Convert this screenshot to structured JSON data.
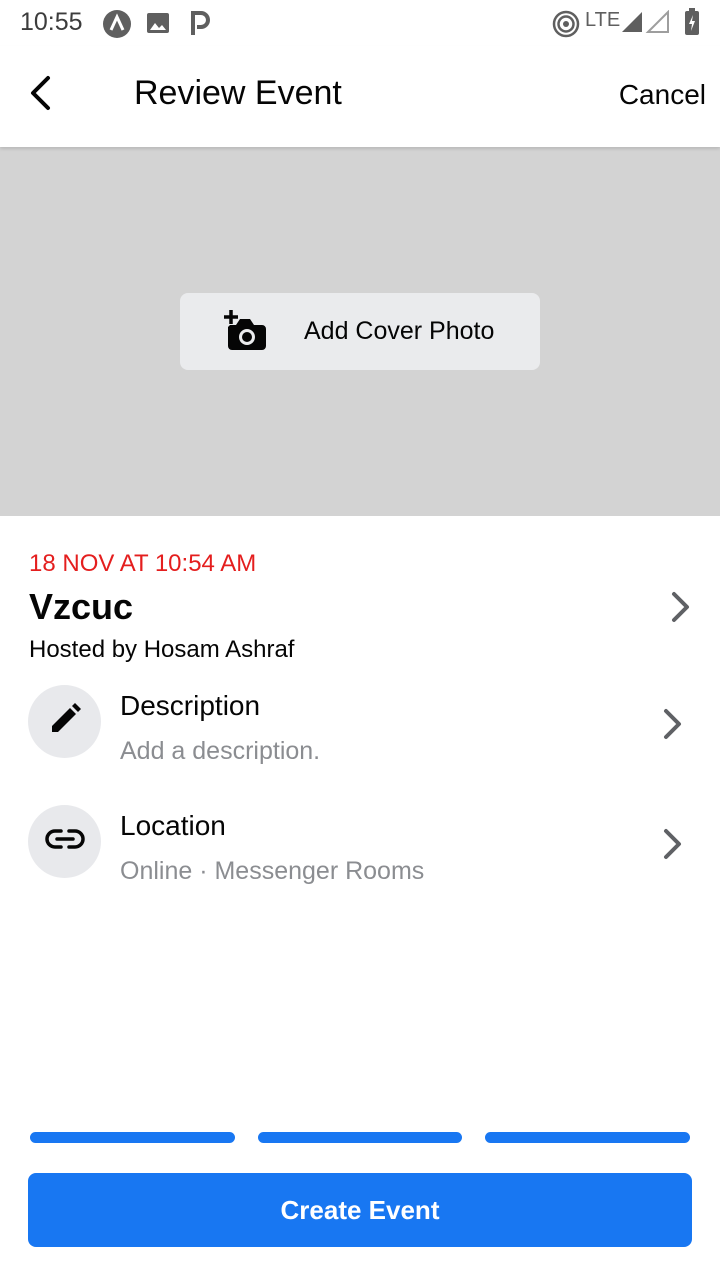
{
  "status_bar": {
    "time": "10:55",
    "network": "LTE",
    "icons": [
      "app-a-icon",
      "image-icon",
      "p-icon",
      "hotspot-icon",
      "signal-icon",
      "battery-icon"
    ]
  },
  "header": {
    "title": "Review Event",
    "cancel_label": "Cancel",
    "back_icon": "chevron-left-icon"
  },
  "cover": {
    "add_cover_label": "Add Cover Photo",
    "icon": "add-camera-icon",
    "background": "#d3d3d3"
  },
  "event": {
    "date_time": "18 NOV AT 10:54 AM",
    "name": "Vzcuc",
    "host": "Hosted by Hosam Ashraf"
  },
  "rows": [
    {
      "title": "Description",
      "subtitle": "Add a description.",
      "icon": "pencil-icon"
    },
    {
      "title": "Location",
      "subtitle": "Online · Messenger Rooms",
      "icon": "link-icon"
    }
  ],
  "progress": {
    "steps_total": 3,
    "steps_completed": 3
  },
  "footer": {
    "create_label": "Create Event"
  },
  "colors": {
    "accent": "#1877f2",
    "date": "#e41e1e",
    "muted": "#8b8d91"
  }
}
